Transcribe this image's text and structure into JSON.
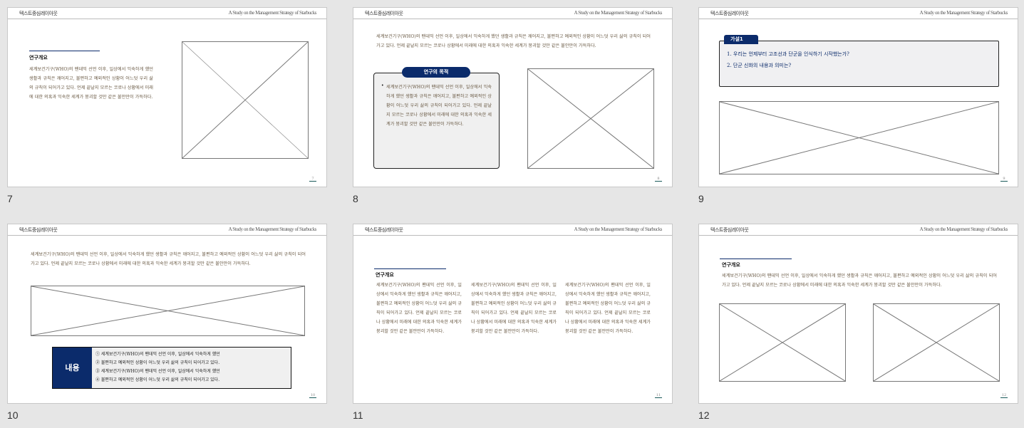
{
  "header": {
    "left": "텍스트중심레이아웃",
    "right": "A Study on the Management Strategy of Starbucks"
  },
  "body_text": "세계보건기구(WHO)의 팬데믹 선언 이후, 일상에서 익숙하게 했던 생활과 규칙은 깨어지고, 불편하고 예외적인 상황이 어느덧 우리 삶의 규칙이 되어가고 있다. 언제 끝날지 모르는 코로나 상황에서 미래에 대한 의혹과 익숙한 세계가 붕괴할 것만 같은 불안만이 가득하다.",
  "section_title": "연구개요",
  "slides": [
    {
      "number": "7",
      "page": "7"
    },
    {
      "number": "8",
      "page": "8",
      "box_title": "연구의 목적",
      "bullet": "•"
    },
    {
      "number": "9",
      "page": "9",
      "tab": "가설1",
      "questions": [
        "1. 우리는 언제부터 고조선과 단군을 인식하기 시작했는가?",
        "2. 단군 신화의 내용과 의미는?"
      ]
    },
    {
      "number": "10",
      "page": "10",
      "label": "내용",
      "items": [
        "①  세계보건기구(WHO)의 팬데믹 선언 이후, 일상에서 익숙하게 했던",
        "②  불편하고 예외적인 상황이 어느덧 우리 삶의 규칙이 되어가고 있다.",
        "③  세계보건기구(WHO)의 팬데믹 선언 이후, 일상에서 익숙하게 했던",
        "④  불편하고 예외적인 상황이 어느덧 우리 삶의 규칙이 되어가고 있다."
      ]
    },
    {
      "number": "11",
      "page": "11"
    },
    {
      "number": "12",
      "page": "12"
    }
  ]
}
